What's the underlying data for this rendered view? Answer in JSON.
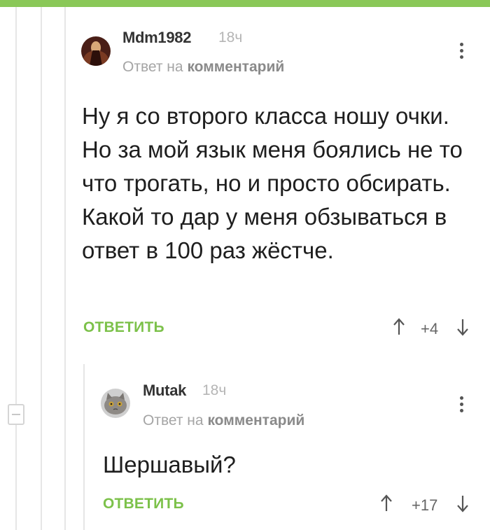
{
  "comments": [
    {
      "author": "Mdm1982",
      "time": "18ч",
      "reply_prefix": "Ответ на",
      "reply_link": "комментарий",
      "body": "Ну я со второго класса ношу очки. Но за мой язык меня боялись не то что трогать, но и просто обсирать. Какой то дар у меня обзываться в ответ в 100 раз жёстче.",
      "reply_label": "ОТВЕТИТЬ",
      "rating": "+4"
    },
    {
      "author": "Mutak",
      "time": "18ч",
      "reply_prefix": "Ответ на",
      "reply_link": "комментарий",
      "body": "Шершавый?",
      "reply_label": "ОТВЕТИТЬ",
      "rating": "+17"
    }
  ],
  "icons": {
    "vote_up": "arrow-up-icon",
    "vote_down": "arrow-down-icon",
    "more": "kebab-menu-icon",
    "collapse": "collapse-minus-icon"
  },
  "colors": {
    "accent": "#7cc14a",
    "topbar": "#8ac858"
  }
}
